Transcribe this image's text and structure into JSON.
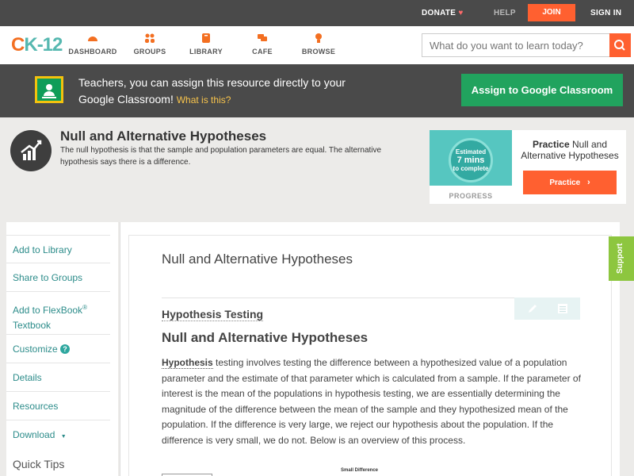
{
  "topbar": {
    "donate": "DONATE",
    "help": "HELP",
    "join": "JOIN",
    "signin": "SIGN IN"
  },
  "nav": {
    "logo_c": "C",
    "logo_k": "K",
    "logo_num": "-12",
    "items": [
      {
        "label": "DASHBOARD",
        "icon": "dashboard-icon"
      },
      {
        "label": "GROUPS",
        "icon": "groups-icon"
      },
      {
        "label": "LIBRARY",
        "icon": "library-icon"
      },
      {
        "label": "CAFE",
        "icon": "cafe-icon"
      },
      {
        "label": "BROWSE",
        "icon": "browse-icon"
      }
    ],
    "search_placeholder": "What do you want to learn today?"
  },
  "banner": {
    "text": "Teachers, you can assign this resource directly to your Google Classroom!",
    "what": "What is this?",
    "button": "Assign to Google Classroom"
  },
  "concept": {
    "title": "Null and Alternative Hypotheses",
    "subtitle": "The null hypothesis is that the sample and population parameters are equal. The alternative hypothesis says there is a difference."
  },
  "practice": {
    "estimated_1": "Estimated",
    "estimated_2": "7 mins",
    "estimated_3": "to complete",
    "progress_label": "PROGRESS",
    "title_bold": "Practice",
    "title_rest": " Null and Alternative Hypotheses",
    "button": "Practice"
  },
  "sidebar": {
    "add_library": "Add to Library",
    "share_groups": "Share to Groups",
    "add_flexbook": "Add to FlexBook",
    "reg": "®",
    "textbook": "Textbook",
    "customize": "Customize",
    "details": "Details",
    "resources": "Resources",
    "download": "Download",
    "download_caret": "▼",
    "quick_tips": "Quick Tips"
  },
  "doc": {
    "title": "Null and Alternative Hypotheses",
    "section": "Hypothesis Testing",
    "heading": "Null and Alternative Hypotheses",
    "keyword": "Hypothesis",
    "paragraph": " testing involves testing the difference between a hypothesized value of a population parameter and the estimate of that parameter which is calculated from a sample. If the parameter of interest is the mean of the populations in hypothesis testing, we are essentially determining the magnitude of the difference between the mean of the sample and they hypothesized mean of the population. If the difference is very large, we reject our hypothesis about the population. If the difference is very small, we do not. Below is an overview of this process.",
    "figure_label": "Small Difference"
  },
  "support": "Support",
  "colors": {
    "accent": "#ff6030",
    "dark": "#4a4a4a",
    "teal": "#2c8c8a",
    "green": "#21a35e",
    "support": "#8dc63f"
  }
}
